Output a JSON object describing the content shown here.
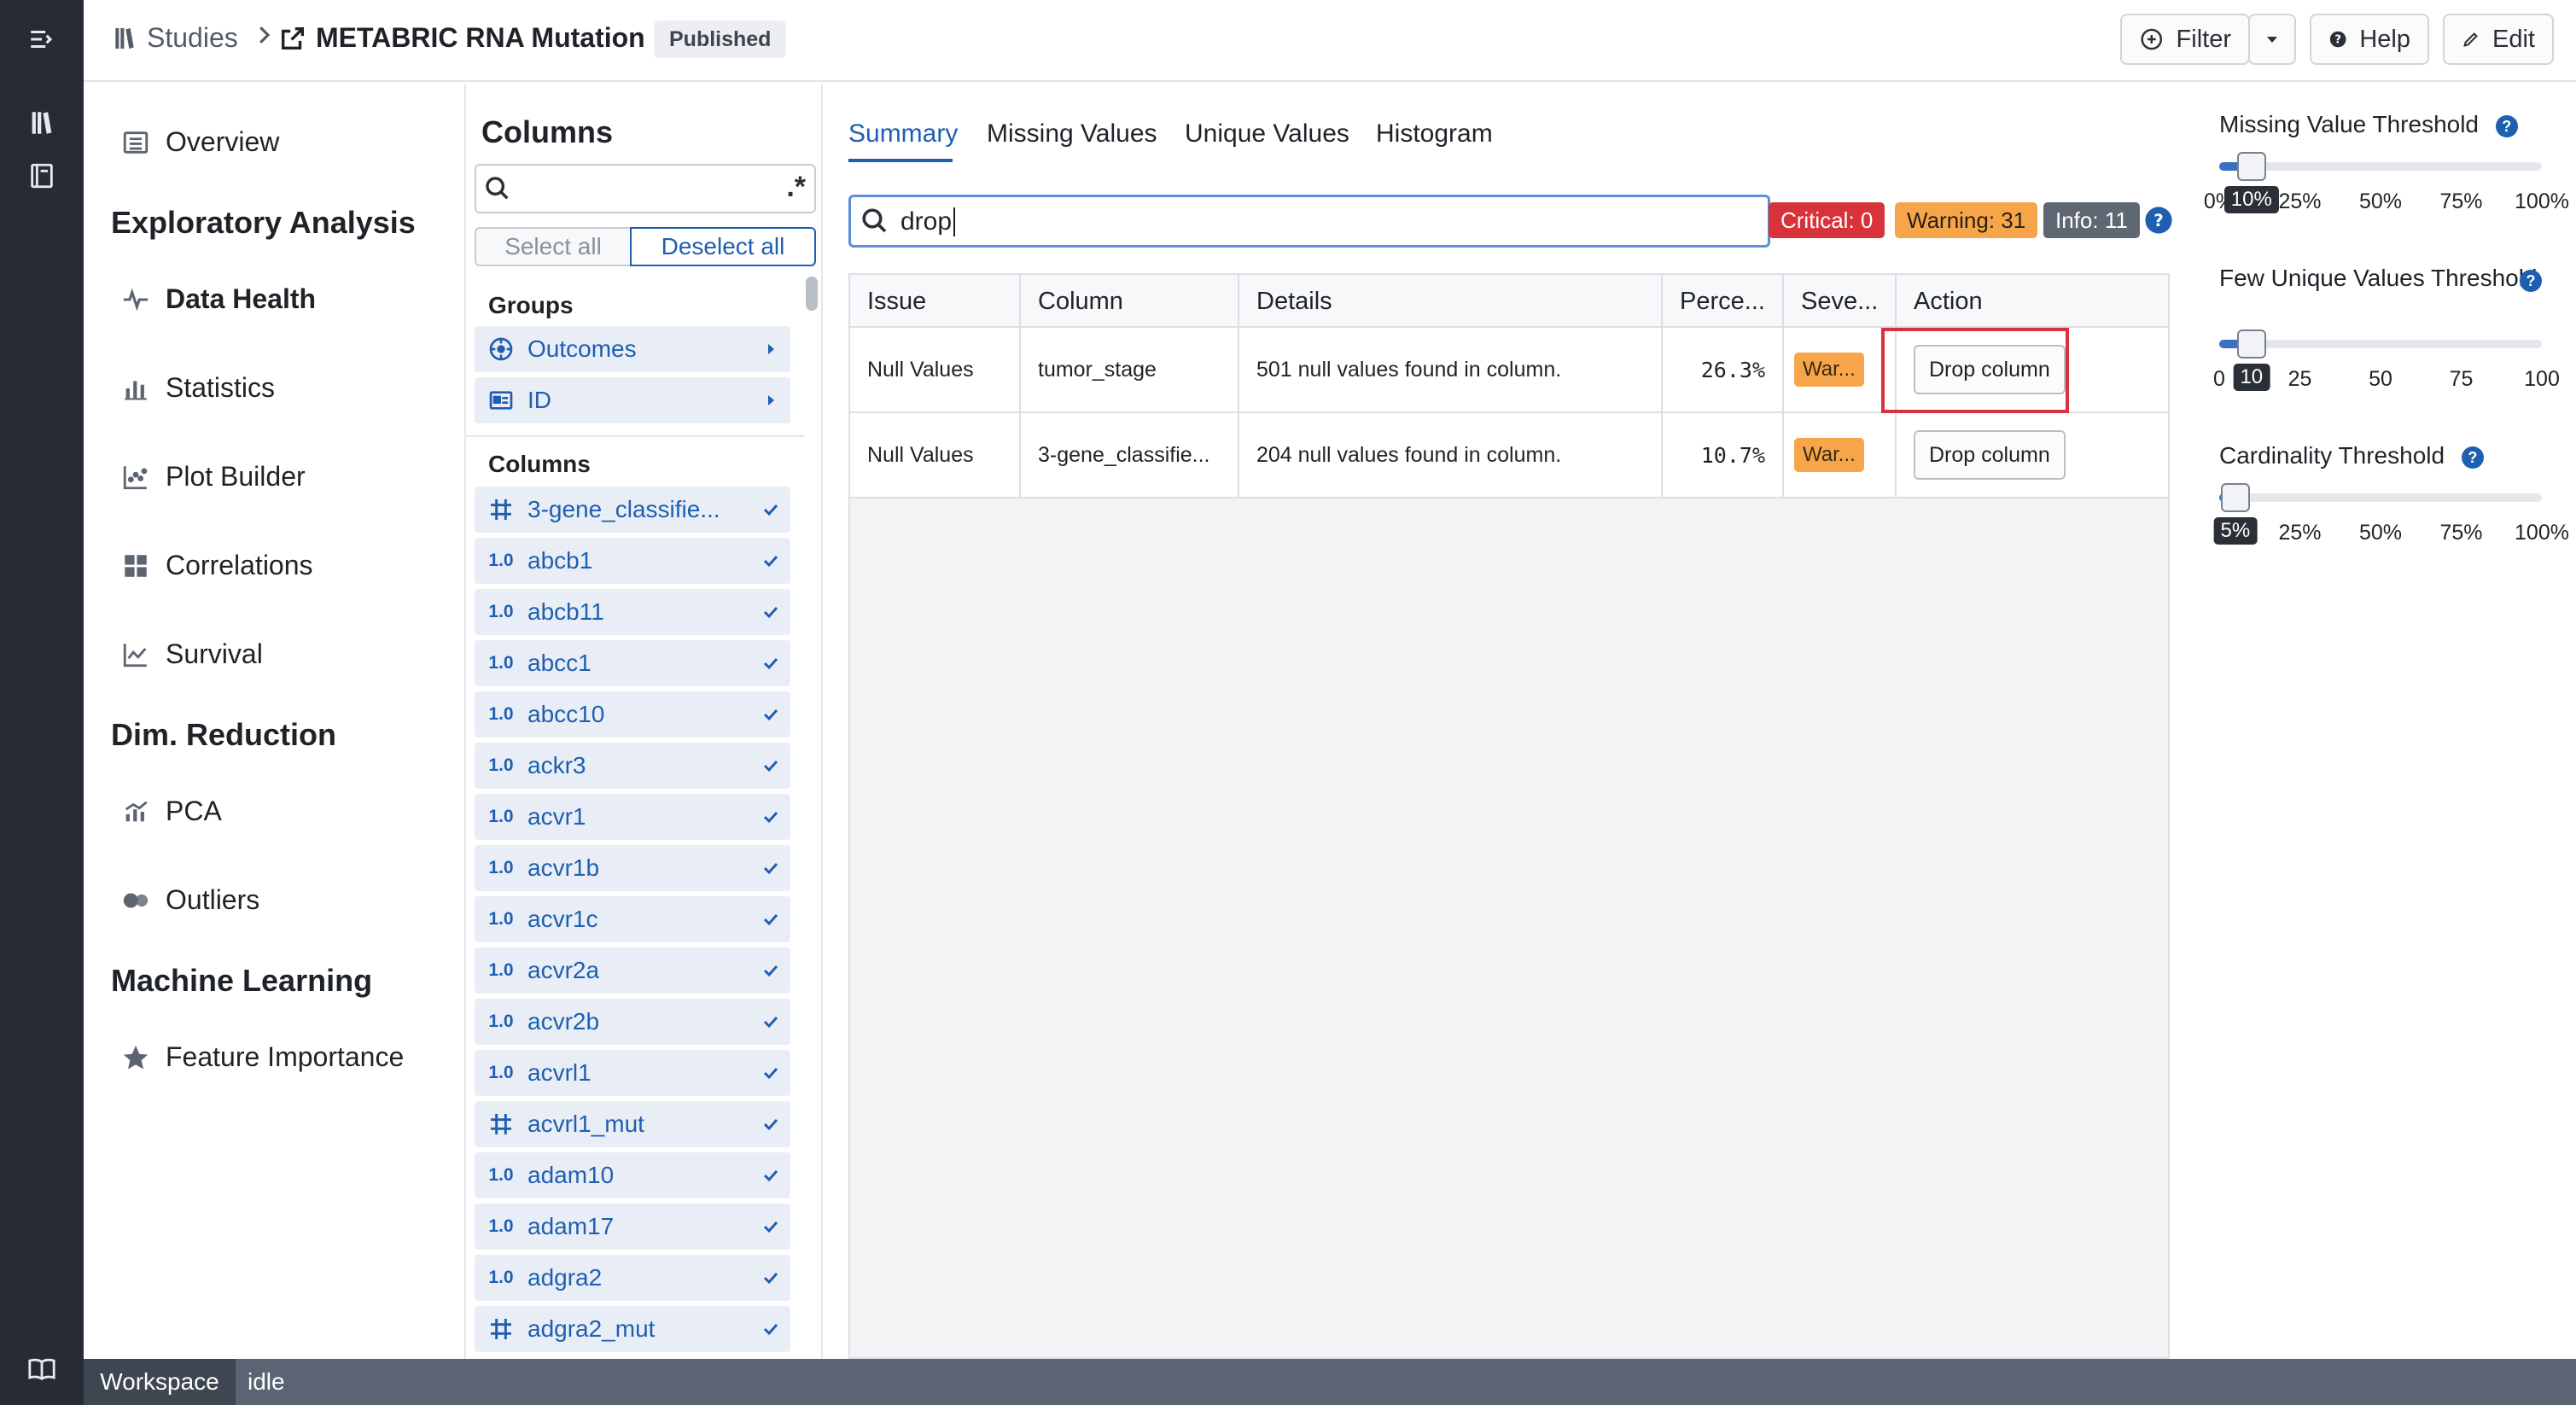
{
  "breadcrumb": {
    "root": "Studies",
    "study": "METABRIC RNA Mutation",
    "status": "Published"
  },
  "toolbar": {
    "filter": "Filter",
    "help": "Help",
    "edit": "Edit"
  },
  "nav": {
    "overview": "Overview",
    "section1": "Exploratory Analysis",
    "data_health": "Data Health",
    "statistics": "Statistics",
    "plot_builder": "Plot Builder",
    "correlations": "Correlations",
    "survival": "Survival",
    "section2": "Dim. Reduction",
    "pca": "PCA",
    "outliers": "Outliers",
    "section3": "Machine Learning",
    "feature_importance": "Feature Importance"
  },
  "columns_panel": {
    "title": "Columns",
    "search_value": "",
    "regex_label": ".*",
    "select_all": "Select all",
    "deselect_all": "Deselect all",
    "groups_header": "Groups",
    "groups": [
      {
        "label": "Outcomes"
      },
      {
        "label": "ID"
      }
    ],
    "columns_header": "Columns",
    "numeric_badge": "1.0",
    "items": [
      {
        "label": "3-gene_classifie...",
        "type": "categorical"
      },
      {
        "label": "abcb1",
        "type": "numeric"
      },
      {
        "label": "abcb11",
        "type": "numeric"
      },
      {
        "label": "abcc1",
        "type": "numeric"
      },
      {
        "label": "abcc10",
        "type": "numeric"
      },
      {
        "label": "ackr3",
        "type": "numeric"
      },
      {
        "label": "acvr1",
        "type": "numeric"
      },
      {
        "label": "acvr1b",
        "type": "numeric"
      },
      {
        "label": "acvr1c",
        "type": "numeric"
      },
      {
        "label": "acvr2a",
        "type": "numeric"
      },
      {
        "label": "acvr2b",
        "type": "numeric"
      },
      {
        "label": "acvrl1",
        "type": "numeric"
      },
      {
        "label": "acvrl1_mut",
        "type": "categorical"
      },
      {
        "label": "adam10",
        "type": "numeric"
      },
      {
        "label": "adam17",
        "type": "numeric"
      },
      {
        "label": "adgra2",
        "type": "numeric"
      },
      {
        "label": "adgra2_mut",
        "type": "categorical"
      }
    ]
  },
  "tabs": [
    "Summary",
    "Missing Values",
    "Unique Values",
    "Histogram"
  ],
  "filter": {
    "value": "drop"
  },
  "severity_counts": {
    "critical": "Critical: 0",
    "warning": "Warning: 31",
    "info": "Info: 11"
  },
  "table": {
    "headers": [
      "Issue",
      "Column",
      "Details",
      "Perce...",
      "Seve...",
      "Action"
    ],
    "rows": [
      {
        "issue": "Null Values",
        "column": "tumor_stage",
        "details": "501 null values found in column.",
        "percent": "26.3%",
        "severity": "War...",
        "action": "Drop column"
      },
      {
        "issue": "Null Values",
        "column": "3-gene_classifie...",
        "details": "204 null values found in column.",
        "percent": "10.7%",
        "severity": "War...",
        "action": "Drop column"
      }
    ]
  },
  "thresholds": {
    "missing": {
      "title": "Missing Value Threshold",
      "value_label": "10%",
      "fraction": 0.1,
      "ticks": [
        "0%",
        "25%",
        "50%",
        "75%",
        "100%"
      ]
    },
    "unique": {
      "title": "Few Unique Values Threshold",
      "value_label": "10",
      "fraction": 0.1,
      "ticks": [
        "0",
        "25",
        "50",
        "75",
        "100"
      ]
    },
    "cardinality": {
      "title": "Cardinality Threshold",
      "value_label": "5%",
      "fraction": 0.05,
      "ticks": [
        "0",
        "25%",
        "50%",
        "75%",
        "100%"
      ]
    }
  },
  "statusbar": {
    "workspace": "Workspace",
    "state": "idle"
  },
  "colors": {
    "accent": "#1f5fb0",
    "critical": "#d8333a",
    "warning": "#f7a54a",
    "info": "#5f6773",
    "highlight": "#d8333a"
  }
}
